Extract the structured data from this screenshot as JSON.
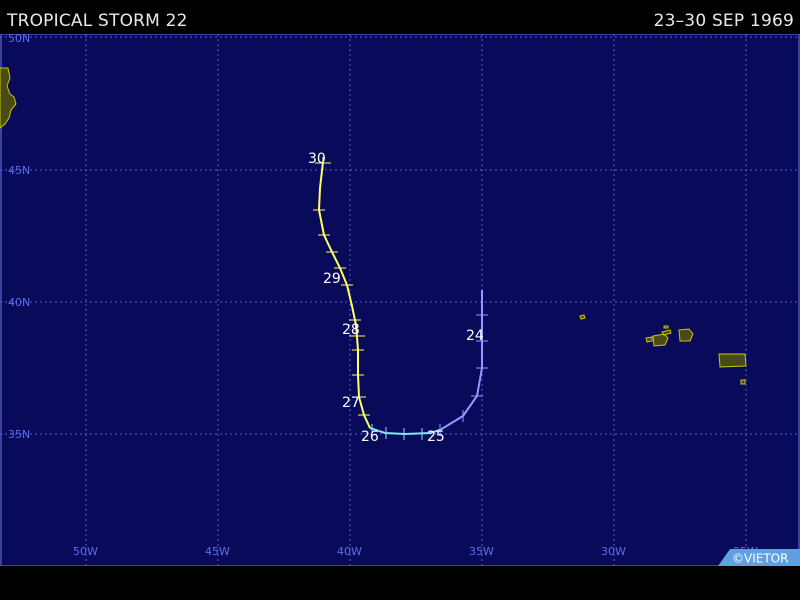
{
  "header": {
    "storm_name": "TROPICAL STORM 22",
    "date_range": "23–30 SEP 1969"
  },
  "map": {
    "background_color": "#0a0a5a",
    "grid_color": "#4a5fd8",
    "land_color": "#4a4a18",
    "coast_color": "#c8c800",
    "lat_labels": [
      "50N",
      "45N",
      "40N",
      "35N"
    ],
    "lon_labels": [
      "50W",
      "45W",
      "40W",
      "35W",
      "30W",
      "25W"
    ]
  },
  "track": {
    "colors": {
      "tropical_storm": "#ffff60",
      "depression": "#7ce8f0",
      "subtropical": "#9898ff"
    },
    "day_labels": [
      "24",
      "25",
      "26",
      "27",
      "28",
      "29",
      "30"
    ]
  },
  "credit": {
    "text": "©VIETOR"
  }
}
